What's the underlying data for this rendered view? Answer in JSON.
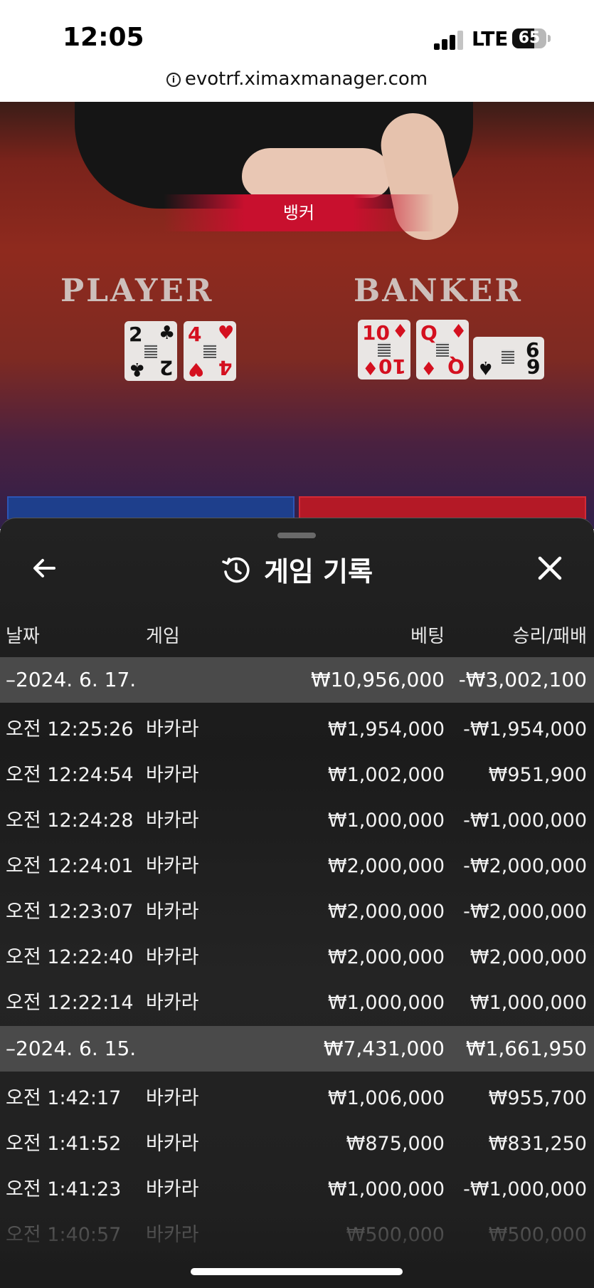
{
  "status_bar": {
    "time": "12:05",
    "network": "LTE",
    "battery_percent": "65",
    "battery_level": 0.65,
    "signal_bars": 3
  },
  "browser": {
    "url": "evotrf.ximaxmanager.com"
  },
  "game": {
    "banker_tag": "뱅커",
    "player_label": "PLAYER",
    "banker_label": "BANKER",
    "player_cards": [
      {
        "rank": "2",
        "suit": "♣",
        "color": "#111111"
      },
      {
        "rank": "4",
        "suit": "♥",
        "color": "#d4101f"
      }
    ],
    "banker_cards": [
      {
        "rank": "10",
        "suit": "♦",
        "color": "#d4101f"
      },
      {
        "rank": "Q",
        "suit": "♦",
        "color": "#d4101f"
      },
      {
        "rank": "6",
        "suit": "♠",
        "color": "#111111"
      }
    ]
  },
  "sheet": {
    "title": "게임 기록",
    "back_icon": "arrow-left-icon",
    "history_icon": "history-clock-icon",
    "close_icon": "close-icon",
    "columns": {
      "date": "날짜",
      "game": "게임",
      "bet": "베팅",
      "result": "승리/패배"
    },
    "groups": [
      {
        "date": "–2024. 6. 17.",
        "bet": "₩10,956,000",
        "result": "-₩3,002,100",
        "rows": [
          {
            "time": "오전 12:25:26",
            "game": "바카라",
            "bet": "₩1,954,000",
            "result": "-₩1,954,000"
          },
          {
            "time": "오전 12:24:54",
            "game": "바카라",
            "bet": "₩1,002,000",
            "result": "₩951,900"
          },
          {
            "time": "오전 12:24:28",
            "game": "바카라",
            "bet": "₩1,000,000",
            "result": "-₩1,000,000"
          },
          {
            "time": "오전 12:24:01",
            "game": "바카라",
            "bet": "₩2,000,000",
            "result": "-₩2,000,000"
          },
          {
            "time": "오전 12:23:07",
            "game": "바카라",
            "bet": "₩2,000,000",
            "result": "-₩2,000,000"
          },
          {
            "time": "오전 12:22:40",
            "game": "바카라",
            "bet": "₩2,000,000",
            "result": "₩2,000,000"
          },
          {
            "time": "오전 12:22:14",
            "game": "바카라",
            "bet": "₩1,000,000",
            "result": "₩1,000,000"
          }
        ]
      },
      {
        "date": "–2024. 6. 15.",
        "bet": "₩7,431,000",
        "result": "₩1,661,950",
        "rows": [
          {
            "time": "오전 1:42:17",
            "game": "바카라",
            "bet": "₩1,006,000",
            "result": "₩955,700"
          },
          {
            "time": "오전 1:41:52",
            "game": "바카라",
            "bet": "₩875,000",
            "result": "₩831,250"
          },
          {
            "time": "오전 1:41:23",
            "game": "바카라",
            "bet": "₩1,000,000",
            "result": "-₩1,000,000"
          },
          {
            "time": "오전 1:40:57",
            "game": "바카라",
            "bet": "₩500,000",
            "result": "₩500,000"
          }
        ]
      }
    ]
  }
}
